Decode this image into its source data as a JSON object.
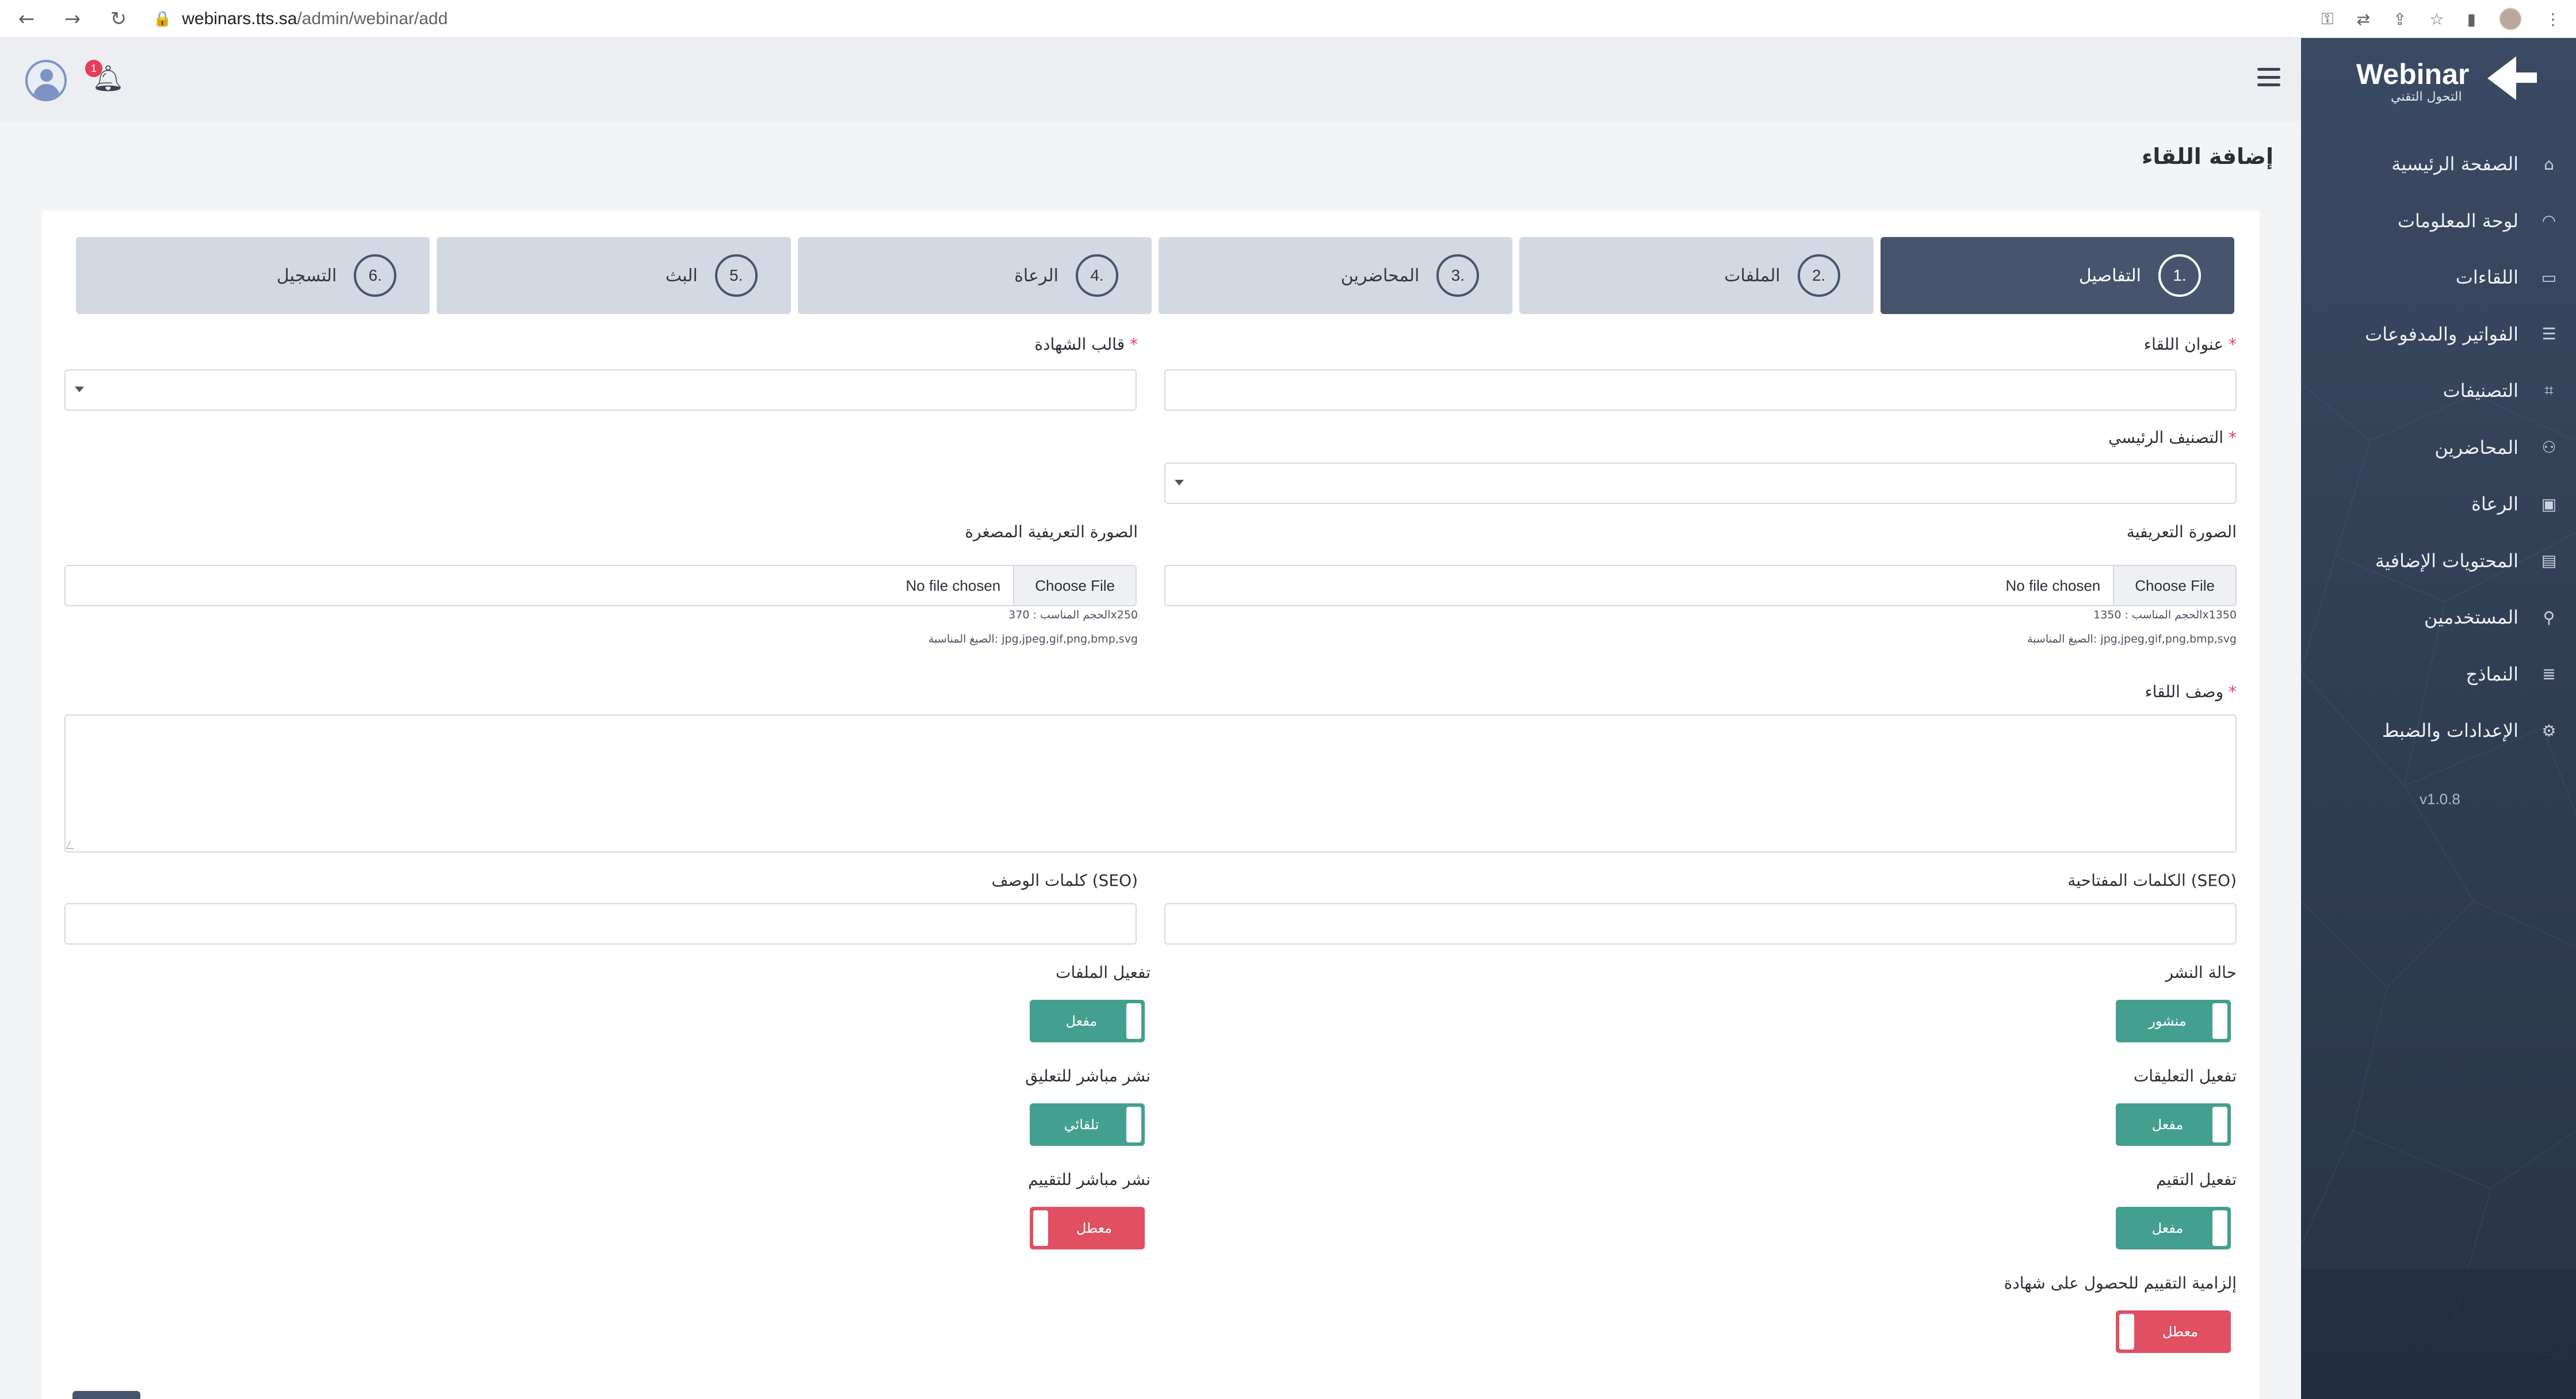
{
  "browser": {
    "url_host": "webinars.tts.sa",
    "url_path": "/admin/webinar/add"
  },
  "header": {
    "notification_count": "1"
  },
  "sidebar": {
    "brand": "Webinar",
    "brand_sub": "التحول التقني",
    "items": [
      {
        "label": "الصفحة الرئيسية",
        "icon": "home-icon"
      },
      {
        "label": "لوحة المعلومات",
        "icon": "dashboard-icon"
      },
      {
        "label": "اللقاءات",
        "icon": "monitor-icon"
      },
      {
        "label": "الفواتير والمدفوعات",
        "icon": "database-icon"
      },
      {
        "label": "التصنيفات",
        "icon": "tag-icon"
      },
      {
        "label": "المحاضرين",
        "icon": "user-icon"
      },
      {
        "label": "الرعاة",
        "icon": "sponsor-icon"
      },
      {
        "label": "المحتويات الإضافية",
        "icon": "book-icon"
      },
      {
        "label": "المستخدمين",
        "icon": "users-icon"
      },
      {
        "label": "النماذج",
        "icon": "list-icon"
      },
      {
        "label": "الإعدادات والضبط",
        "icon": "gear-icon"
      }
    ],
    "version": "v1.0.8"
  },
  "page": {
    "title": "إضافة اللقاء"
  },
  "steps": [
    {
      "num": "1.",
      "label": "التفاصيل",
      "active": true
    },
    {
      "num": "2.",
      "label": "الملفات",
      "active": false
    },
    {
      "num": "3.",
      "label": "المحاضرين",
      "active": false
    },
    {
      "num": "4.",
      "label": "الرعاة",
      "active": false
    },
    {
      "num": "5.",
      "label": "البث",
      "active": false
    },
    {
      "num": "6.",
      "label": "التسجيل",
      "active": false
    }
  ],
  "form": {
    "required_mark": "*",
    "title_label": "عنوان اللقاء",
    "certificate_label": "قالب الشهادة",
    "category_label": "التصنيف الرئيسي",
    "image_label": "الصورة التعريفية",
    "thumb_label": "الصورة التعريفية المصغرة",
    "choose_file": "Choose File",
    "no_file": "No file chosen",
    "image_size_hint": "الحجم المناسب : 1350x1350",
    "thumb_size_hint": "الحجم المناسب : 370x250",
    "formats_hint": "الصيغ المناسبة: jpg,jpeg,gif,png,bmp,svg",
    "description_label": "وصف اللقاء",
    "seo_keywords_label": "الكلمات المفتاحية (SEO)",
    "seo_description_label": "كلمات الوصف (SEO)"
  },
  "toggles": {
    "publish_label": "حالة النشر",
    "publish_value": "منشور",
    "files_label": "تفعيل الملفات",
    "files_value": "مفعل",
    "comments_label": "تفعيل التعليقات",
    "comments_value": "مفعل",
    "auto_comment_label": "نشر مباشر للتعليق",
    "auto_comment_value": "تلقائي",
    "rating_label": "تفعيل التقيم",
    "rating_value": "مفعل",
    "auto_rating_label": "نشر مباشر للتقييم",
    "auto_rating_value": "معطل",
    "rating_required_label": "إلزامية التقييم للحصول على شهادة",
    "rating_required_value": "معطل"
  },
  "colors": {
    "toggle_on": "#43a08f",
    "toggle_off": "#e04f62",
    "sidebar": "#3b4a63",
    "active_step": "#46556d"
  }
}
